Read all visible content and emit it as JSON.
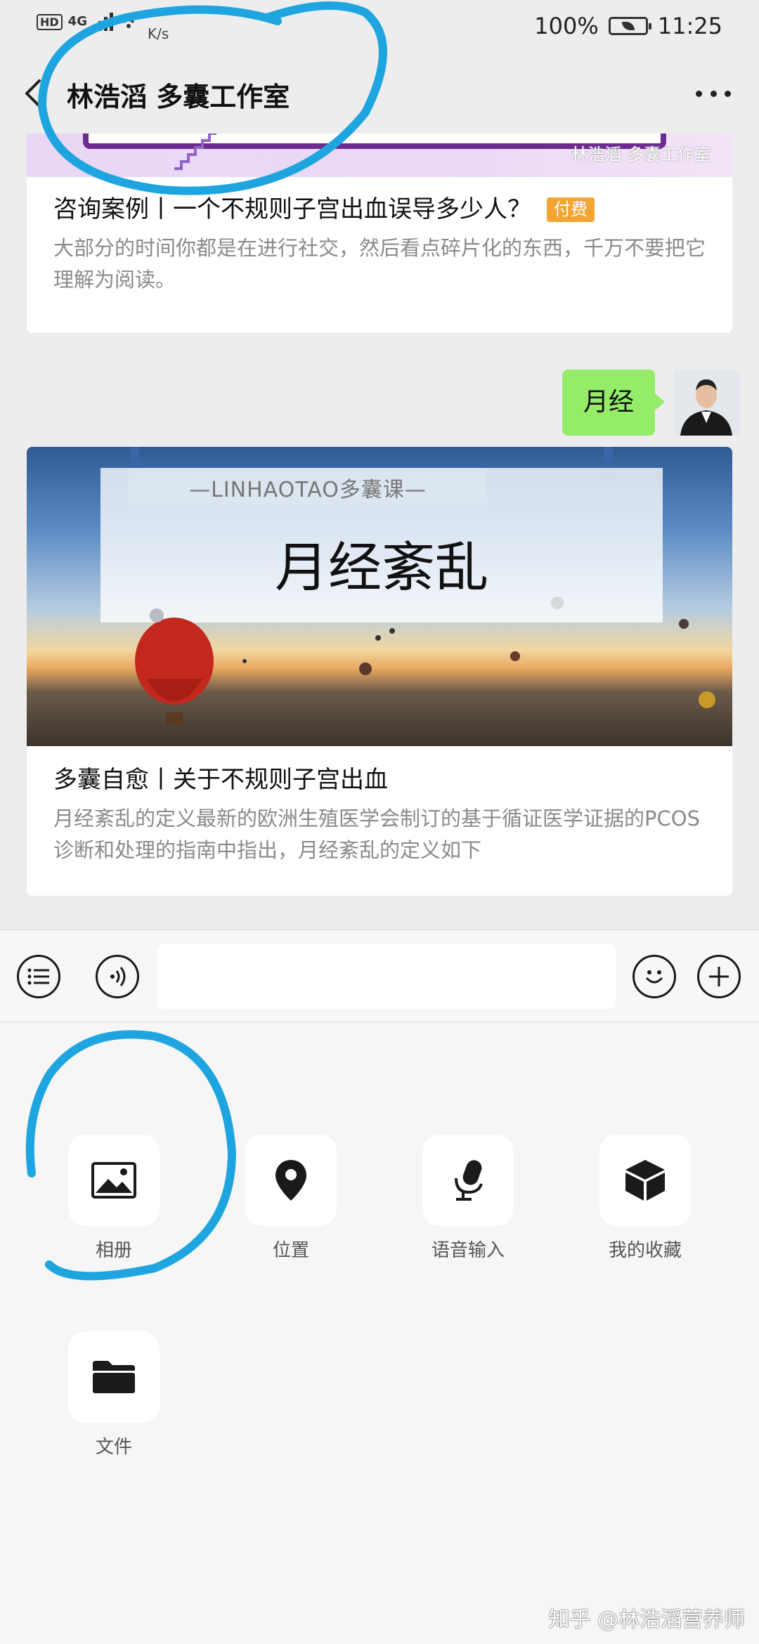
{
  "status_bar": {
    "hd": "HD",
    "network": "4G",
    "speed_unit": "K/s",
    "battery": "100%",
    "time": "11:25"
  },
  "nav": {
    "title": "林浩滔 多囊工作室"
  },
  "card1": {
    "image_watermark": "林浩滔 多囊工作室",
    "title": "咨询案例丨一个不规则子宫出血误导多少人？",
    "badge": "付费",
    "description": "大部分的时间你都是在进行社交，然后看点碎片化的东西，千万不要把它理解为阅读。"
  },
  "message": {
    "text": "月经"
  },
  "card2": {
    "image_subtitle": "—LINHAOTAO多囊课—",
    "image_title": "月经紊乱",
    "title": "多囊自愈丨关于不规则子宫出血",
    "description": "月经紊乱的定义最新的欧洲生殖医学会制订的基于循证医学证据的PCOS诊断和处理的指南中指出，月经紊乱的定义如下"
  },
  "input_bar": {
    "text_value": ""
  },
  "panel": {
    "items": [
      {
        "label": "相册",
        "icon": "photo-album-icon"
      },
      {
        "label": "位置",
        "icon": "location-pin-icon"
      },
      {
        "label": "语音输入",
        "icon": "microphone-icon"
      },
      {
        "label": "我的收藏",
        "icon": "favorites-box-icon"
      },
      {
        "label": "文件",
        "icon": "folder-icon"
      }
    ]
  },
  "watermark": "知乎 @林浩滔营养师",
  "colors": {
    "bubble": "#95ec69",
    "badge": "#f2a532",
    "annotation": "#1ea5e0"
  }
}
